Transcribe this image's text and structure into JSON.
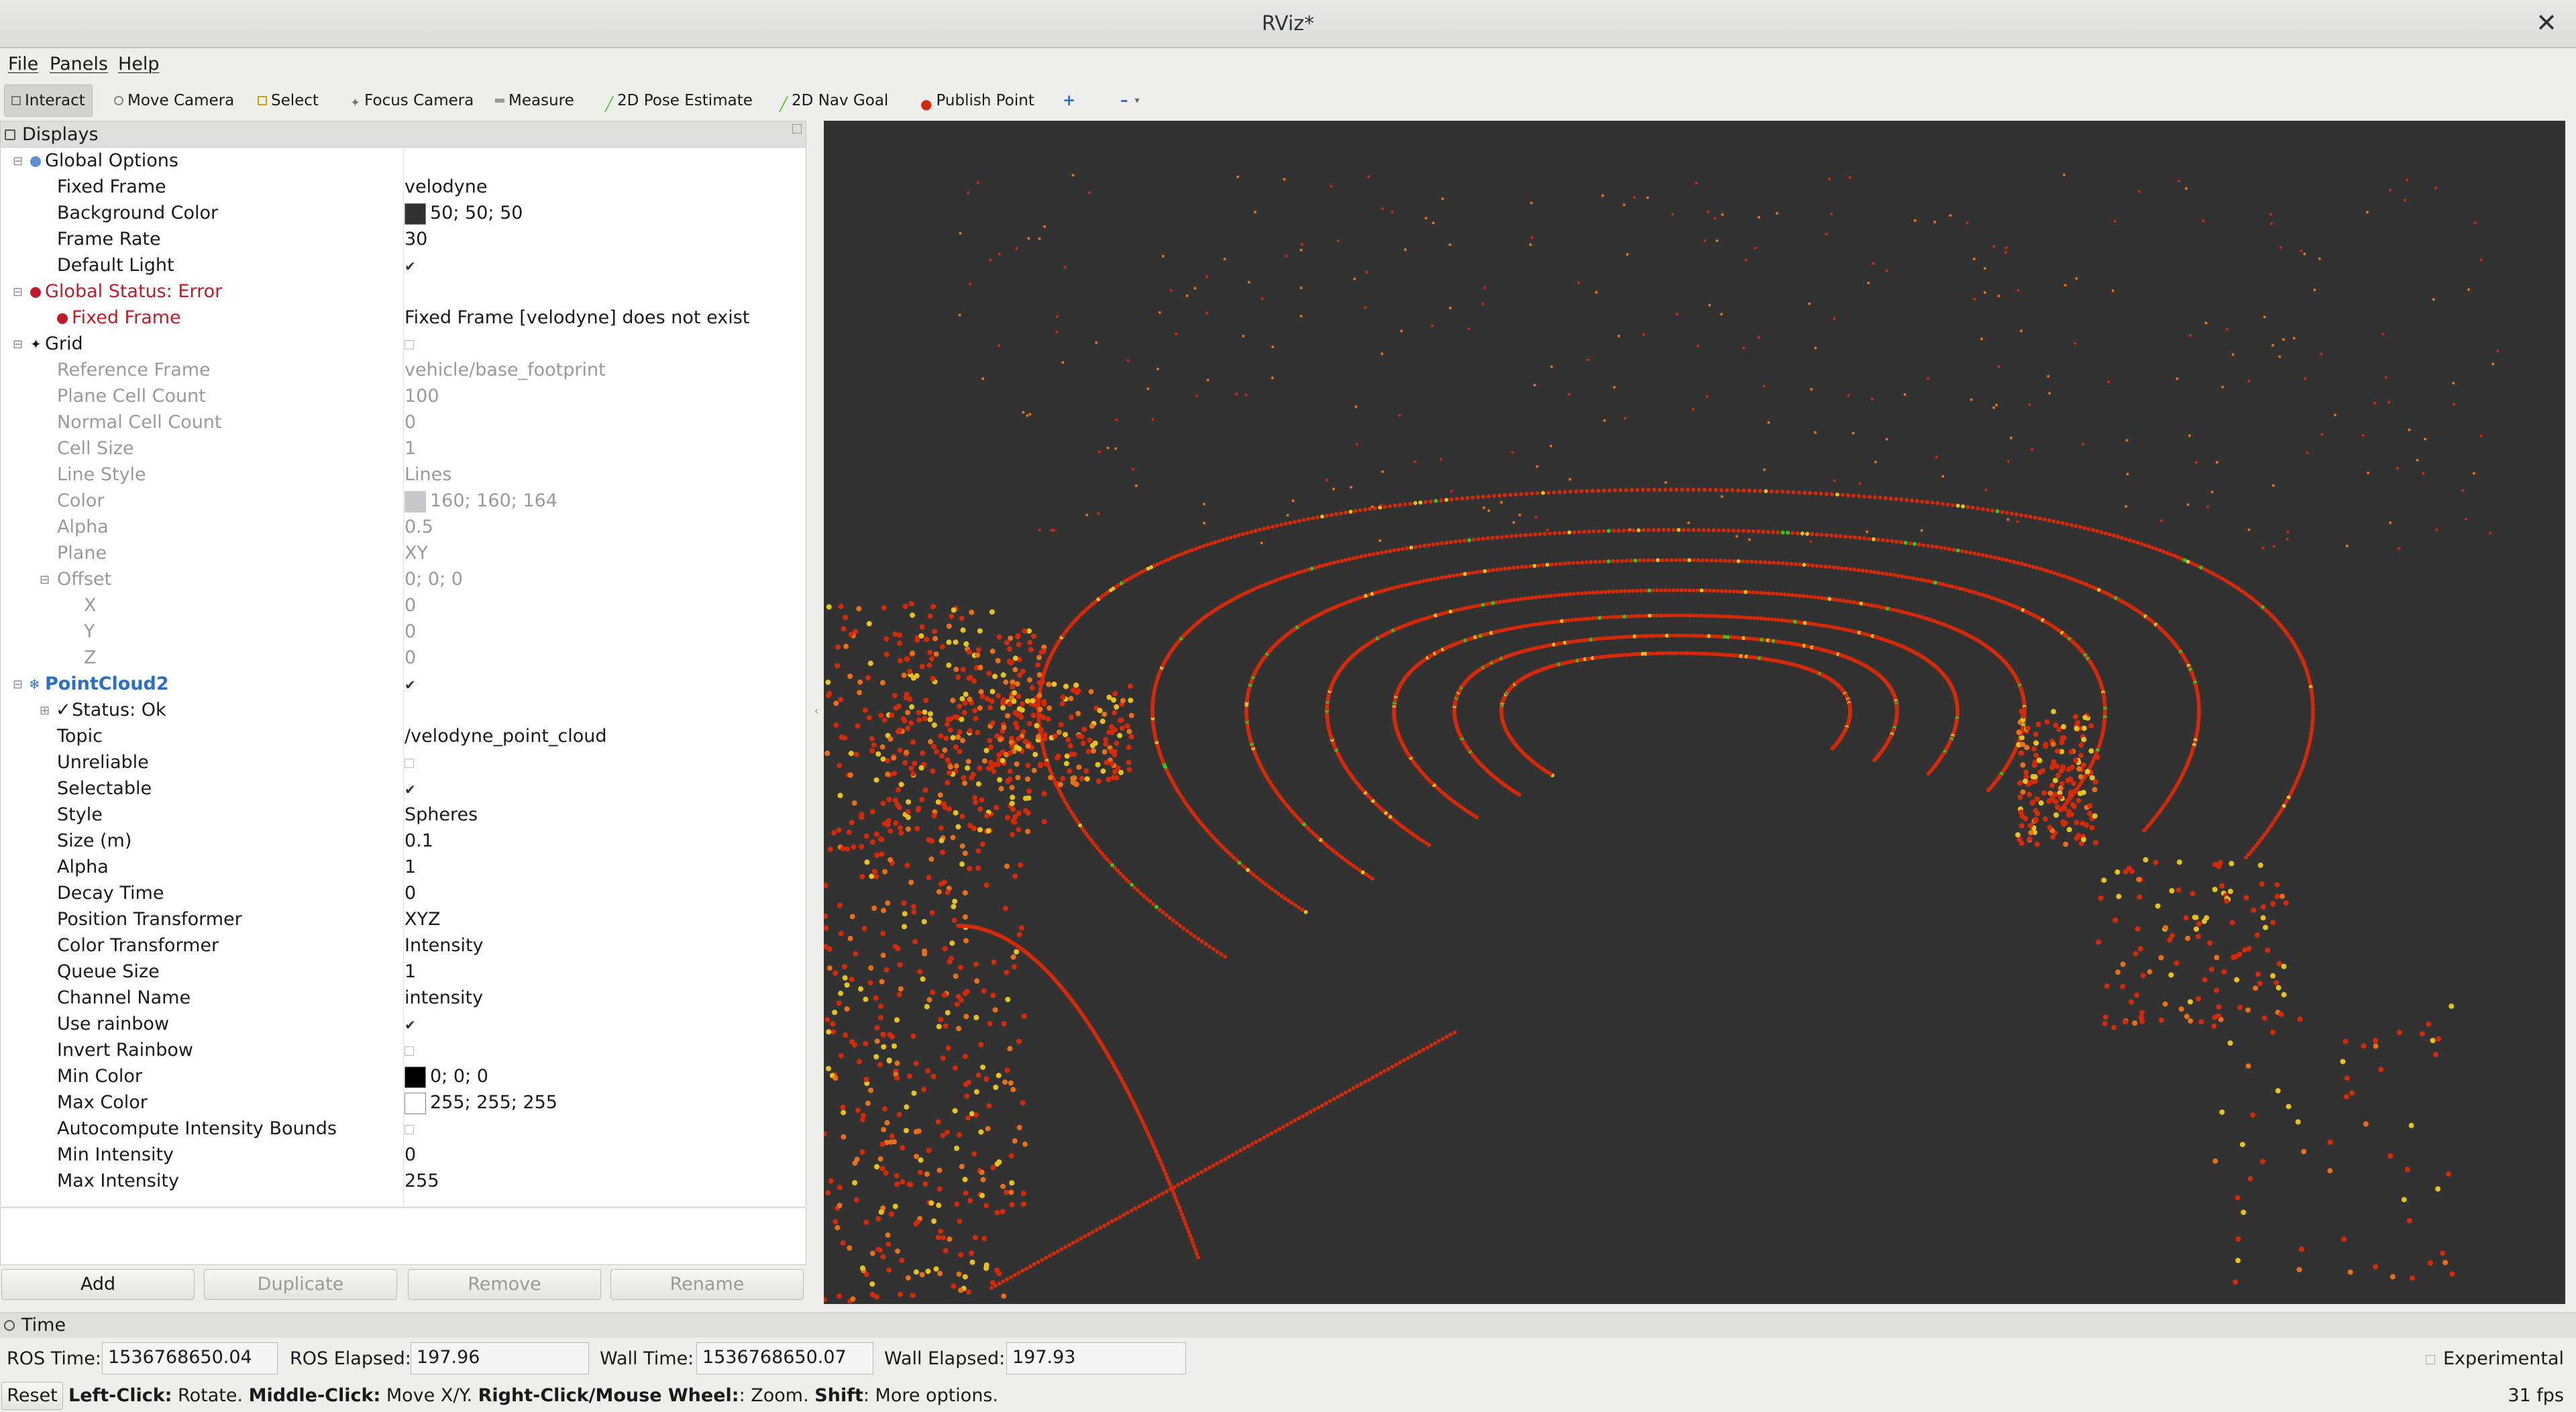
{
  "window": {
    "title": "RViz*"
  },
  "menu": [
    "File",
    "Panels",
    "Help"
  ],
  "toolbar": {
    "interact": "Interact",
    "move_camera": "Move Camera",
    "select": "Select",
    "focus_camera": "Focus Camera",
    "measure": "Measure",
    "pose_estimate": "2D Pose Estimate",
    "nav_goal": "2D Nav Goal",
    "publish_point": "Publish Point",
    "plus": "+",
    "minus": "–"
  },
  "displays": {
    "title": "Displays",
    "global_options": {
      "label": "Global Options",
      "fixed_frame": {
        "k": "Fixed Frame",
        "v": "velodyne"
      },
      "background_color": {
        "k": "Background Color",
        "v": "50; 50; 50",
        "color": "#323232"
      },
      "frame_rate": {
        "k": "Frame Rate",
        "v": "30"
      },
      "default_light": {
        "k": "Default Light"
      }
    },
    "global_status": {
      "label": "Global Status: Error",
      "fixed_frame": {
        "k": "Fixed Frame",
        "v": "Fixed Frame [velodyne] does not exist"
      }
    },
    "grid": {
      "label": "Grid",
      "reference_frame": {
        "k": "Reference Frame",
        "v": "vehicle/base_footprint"
      },
      "plane_cell_count": {
        "k": "Plane Cell Count",
        "v": "100"
      },
      "normal_cell_count": {
        "k": "Normal Cell Count",
        "v": "0"
      },
      "cell_size": {
        "k": "Cell Size",
        "v": "1"
      },
      "line_style": {
        "k": "Line Style",
        "v": "Lines"
      },
      "color": {
        "k": "Color",
        "v": "160; 160; 164",
        "color": "#a0a0a4"
      },
      "alpha": {
        "k": "Alpha",
        "v": "0.5"
      },
      "plane": {
        "k": "Plane",
        "v": "XY"
      },
      "offset": {
        "k": "Offset",
        "v": "0; 0; 0"
      },
      "x": {
        "k": "X",
        "v": "0"
      },
      "y": {
        "k": "Y",
        "v": "0"
      },
      "z": {
        "k": "Z",
        "v": "0"
      }
    },
    "pointcloud": {
      "label": "PointCloud2",
      "status": "Status: Ok",
      "topic": {
        "k": "Topic",
        "v": "/velodyne_point_cloud"
      },
      "unreliable": {
        "k": "Unreliable"
      },
      "selectable": {
        "k": "Selectable"
      },
      "style": {
        "k": "Style",
        "v": "Spheres"
      },
      "size": {
        "k": "Size (m)",
        "v": "0.1"
      },
      "alpha": {
        "k": "Alpha",
        "v": "1"
      },
      "decay_time": {
        "k": "Decay Time",
        "v": "0"
      },
      "position_transformer": {
        "k": "Position Transformer",
        "v": "XYZ"
      },
      "color_transformer": {
        "k": "Color Transformer",
        "v": "Intensity"
      },
      "queue_size": {
        "k": "Queue Size",
        "v": "1"
      },
      "channel_name": {
        "k": "Channel Name",
        "v": "intensity"
      },
      "use_rainbow": {
        "k": "Use rainbow"
      },
      "invert_rainbow": {
        "k": "Invert Rainbow"
      },
      "min_color": {
        "k": "Min Color",
        "v": "0; 0; 0",
        "color": "#000000"
      },
      "max_color": {
        "k": "Max Color",
        "v": "255; 255; 255",
        "color": "#ffffff"
      },
      "autocompute": {
        "k": "Autocompute Intensity Bounds"
      },
      "min_intensity": {
        "k": "Min Intensity",
        "v": "0"
      },
      "max_intensity": {
        "k": "Max Intensity",
        "v": "255"
      }
    },
    "buttons": {
      "add": "Add",
      "duplicate": "Duplicate",
      "remove": "Remove",
      "rename": "Rename"
    }
  },
  "time": {
    "title": "Time",
    "ros_time_label": "ROS Time:",
    "ros_time": "1536768650.04",
    "ros_elapsed_label": "ROS Elapsed:",
    "ros_elapsed": "197.96",
    "wall_time_label": "Wall Time:",
    "wall_time": "1536768650.07",
    "wall_elapsed_label": "Wall Elapsed:",
    "wall_elapsed": "197.93",
    "experimental": "Experimental"
  },
  "status": {
    "reset": "Reset",
    "hint_left_b": "Left-Click:",
    "hint_left": " Rotate. ",
    "hint_mid_b": "Middle-Click:",
    "hint_mid": " Move X/Y. ",
    "hint_right_b": "Right-Click/Mouse Wheel:",
    "hint_right": ": Zoom. ",
    "hint_shift_b": "Shift",
    "hint_shift": ": More options.",
    "fps": "31 fps"
  },
  "colors": {
    "error": "#c01c28",
    "accent": "#2a6fc9",
    "point_red": "#d42a0a",
    "point_orange": "#e8701a",
    "point_yellow": "#e6c21a",
    "point_green": "#3cc41e"
  }
}
